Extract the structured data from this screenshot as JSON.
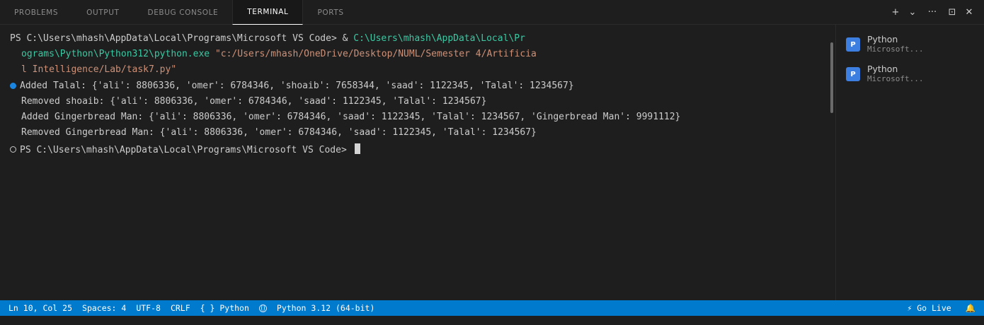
{
  "panel": {
    "tabs": [
      {
        "label": "PROBLEMS"
      },
      {
        "label": "OUTPUT"
      },
      {
        "label": "DEBUG CONSOLE"
      },
      {
        "label": "TERMINAL"
      },
      {
        "label": "PORTS"
      }
    ],
    "active_tab": "TERMINAL",
    "actions": {
      "new_terminal_icon": "+",
      "launch_profile_icon": "⌄",
      "more_icon": "···",
      "maximize_icon": "⊡",
      "close_icon": "✕"
    }
  },
  "terminal": {
    "command": {
      "prompt": "PS C:\\Users\\mhash\\AppData\\Local\\Programs\\Microsoft VS Code> & ",
      "exe_part1": "C:\\Users\\mhash\\AppData\\Local\\Pr",
      "exe_part2": "ograms\\Python\\Python312\\python.exe",
      "arg_part1": "\"c:/Users/mhash/OneDrive/Desktop/NUML/Semester 4/Artificia",
      "arg_part2": "l Intelligence/Lab/task7.py\""
    },
    "output": [
      "Added Talal: {'ali': 8806336, 'omer': 6784346, 'shoaib': 7658344, 'saad': 1122345, 'Talal': 1234567}",
      "Removed shoaib: {'ali': 8806336, 'omer': 6784346, 'saad': 1122345, 'Talal': 1234567}",
      "Added Gingerbread Man: {'ali': 8806336, 'omer': 6784346, 'saad': 1122345, 'Talal': 1234567, 'Gingerbread Man': 9991112}",
      "Removed Gingerbread Man: {'ali': 8806336, 'omer': 6784346, 'saad': 1122345, 'Talal': 1234567}"
    ],
    "final_prompt": "PS C:\\Users\\mhash\\AppData\\Local\\Programs\\Microsoft VS Code> "
  },
  "terminal_list": [
    {
      "name": "Python",
      "subtitle": "Microsoft...",
      "icon_letter": "P"
    },
    {
      "name": "Python",
      "subtitle": "Microsoft...",
      "icon_letter": "P"
    }
  ],
  "statusbar": {
    "position": "Ln 10, Col 25",
    "spaces": "Spaces: 4",
    "encoding": "UTF-8",
    "eol": "CRLF",
    "language": "{ } Python",
    "interpreter": "Python 3.12 (64-bit)",
    "go_live": "⚡ Go Live",
    "bell_icon": "🔔"
  },
  "colors": {
    "accent": "#007acc",
    "path_green": "#3ac9a3",
    "string_orange": "#ce9178",
    "success_dot": "#1a85e0"
  }
}
